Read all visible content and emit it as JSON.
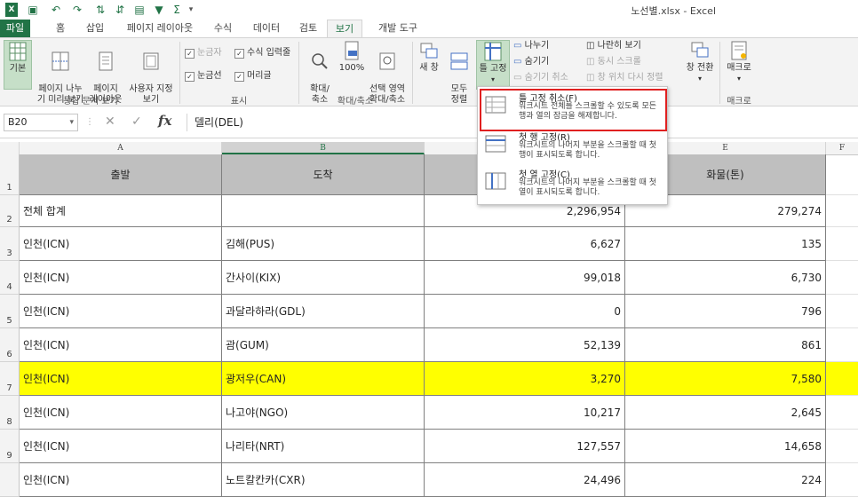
{
  "window": {
    "title": "노선별.xlsx - Excel"
  },
  "tabs": [
    "파일",
    "홈",
    "삽입",
    "페이지 레이아웃",
    "수식",
    "데이터",
    "검토",
    "보기",
    "개발 도구"
  ],
  "ribbon": {
    "views": {
      "normal": "기본",
      "page_break": "페이지 나누\n기 미리 보기",
      "page_layout": "페이지\n레이아웃",
      "custom": "사용자 지정\n보기",
      "label": "통합 문서 보기"
    },
    "show": {
      "ruler": "눈금자",
      "formula_bar": "수식 입력줄",
      "gridlines": "눈금선",
      "headings": "머리글",
      "label": "표시"
    },
    "zoom": {
      "zoom": "확대/\n축소",
      "z100": "100%",
      "selection": "선택 영역\n확대/축소",
      "label": "확대/축소"
    },
    "window": {
      "new_window": "새 창",
      "arrange_all": "모두\n정렬",
      "freeze": "틀 고정",
      "split": "나누기",
      "hide": "숨기기",
      "unhide": "숨기기 취소",
      "side_by_side": "나란히 보기",
      "sync_scroll": "동시 스크롤",
      "reset_pos": "창 위치 다시 정렬",
      "switch": "창 전환"
    },
    "macros": {
      "macro": "매크로",
      "label": "매크로"
    }
  },
  "formula_bar": {
    "name_box": "B20",
    "cancel": "✕",
    "enter": "✓",
    "fx": "fx",
    "content": "델리(DEL)"
  },
  "columns": [
    "A",
    "B",
    "E",
    "F"
  ],
  "rows": [
    {
      "num": "1",
      "a": "출발",
      "b": "도착",
      "d": "",
      "e": "화물(톤)"
    },
    {
      "num": "2",
      "a": "전체 합계",
      "b": "",
      "d": "2,296,954",
      "e": "279,274"
    },
    {
      "num": "3",
      "a": "인천(ICN)",
      "b": "김해(PUS)",
      "d": "6,627",
      "e": "135"
    },
    {
      "num": "4",
      "a": "인천(ICN)",
      "b": "간사이(KIX)",
      "d": "99,018",
      "e": "6,730"
    },
    {
      "num": "5",
      "a": "인천(ICN)",
      "b": "과달라하라(GDL)",
      "d": "0",
      "e": "796"
    },
    {
      "num": "6",
      "a": "인천(ICN)",
      "b": "괌(GUM)",
      "d": "52,139",
      "e": "861"
    },
    {
      "num": "7",
      "a": "인천(ICN)",
      "b": "광저우(CAN)",
      "d": "3,270",
      "e": "7,580"
    },
    {
      "num": "8",
      "a": "인천(ICN)",
      "b": "나고야(NGO)",
      "d": "10,217",
      "e": "2,645"
    },
    {
      "num": "9",
      "a": "인천(ICN)",
      "b": "나리타(NRT)",
      "d": "127,557",
      "e": "14,658"
    },
    {
      "num": "",
      "a": "인천(ICN)",
      "b": "노트칼칸카(CXR)",
      "d": "24,496",
      "e": "224"
    }
  ],
  "freeze_menu": [
    {
      "title": "틀 고정 취소(F)",
      "desc": "워크시트 전체를 스크롤할 수 있도록 모든 행과 열의 잠금을 해제합니다."
    },
    {
      "title": "첫 행 고정(R)",
      "desc": "워크시트의 나머지 부분을 스크롤할 때 첫 행이 표시되도록 합니다."
    },
    {
      "title": "첫 열 고정(C)",
      "desc": "워크시트의 나머지 부분을 스크롤할 때 첫 열이 표시되도록 합니다."
    }
  ],
  "colors": {
    "excel_green": "#217346",
    "highlight": "#ffff00",
    "header_fill": "#bfbfbf",
    "callout": "#e02020"
  }
}
